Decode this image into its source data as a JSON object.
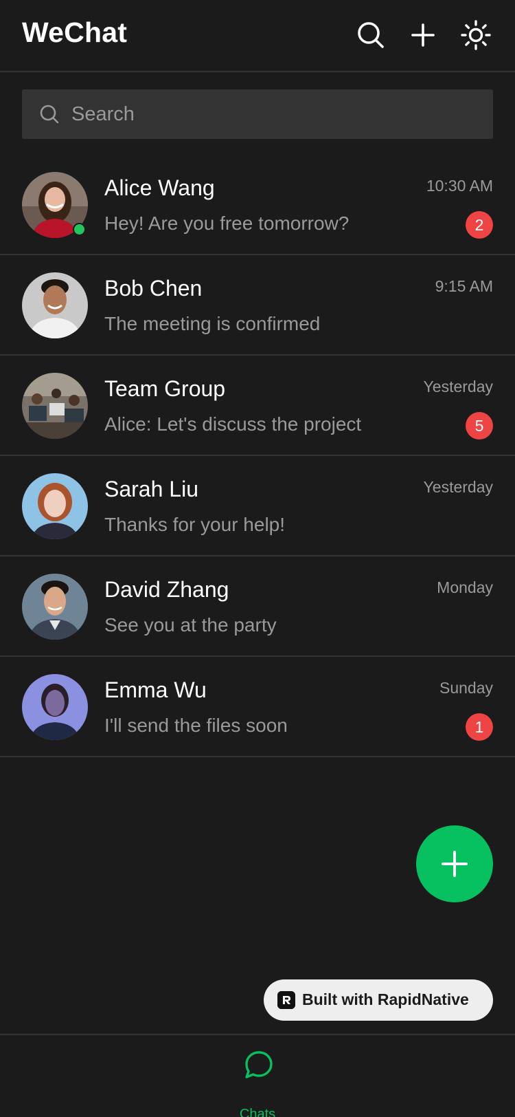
{
  "header": {
    "title": "WeChat",
    "icons": [
      "search-icon",
      "plus-icon",
      "sun-icon"
    ]
  },
  "search": {
    "placeholder": "Search",
    "value": ""
  },
  "chats": [
    {
      "name": "Alice Wang",
      "time": "10:30 AM",
      "preview": "Hey! Are you free tomorrow?",
      "unread": "2",
      "online": true
    },
    {
      "name": "Bob Chen",
      "time": "9:15 AM",
      "preview": "The meeting is confirmed",
      "unread": "",
      "online": false
    },
    {
      "name": "Team Group",
      "time": "Yesterday",
      "preview": "Alice: Let's discuss the project",
      "unread": "5",
      "online": false
    },
    {
      "name": "Sarah Liu",
      "time": "Yesterday",
      "preview": "Thanks for your help!",
      "unread": "",
      "online": false
    },
    {
      "name": "David Zhang",
      "time": "Monday",
      "preview": "See you at the party",
      "unread": "",
      "online": false
    },
    {
      "name": "Emma Wu",
      "time": "Sunday",
      "preview": "I'll send the files soon",
      "unread": "1",
      "online": false
    }
  ],
  "built_with": {
    "label": "Built with RapidNative"
  },
  "bottom_nav": {
    "chats_label": "Chats"
  },
  "colors": {
    "background": "#1b1b1b",
    "accent": "#07c160",
    "badge": "#ef4444",
    "online": "#22c55e"
  }
}
